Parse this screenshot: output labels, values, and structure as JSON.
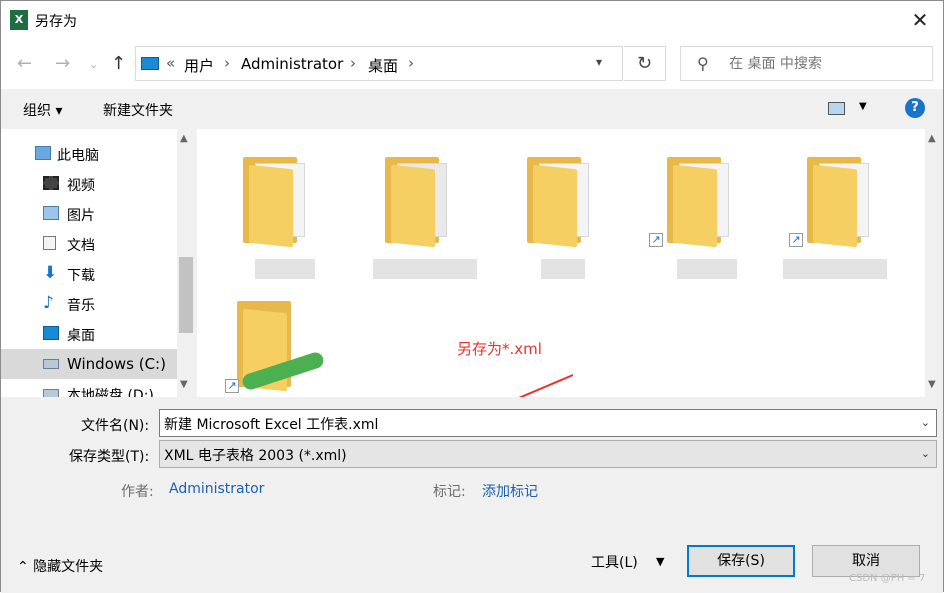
{
  "window": {
    "title": "另存为",
    "app_icon": "excel-icon",
    "close_label": "✕"
  },
  "address": {
    "breadcrumb": [
      "«",
      "用户",
      "Administrator",
      "桌面"
    ],
    "refresh_icon": "refresh-icon",
    "search_placeholder": "在 桌面 中搜索"
  },
  "toolbar": {
    "organize": "组织 ▾",
    "new_folder": "新建文件夹",
    "help": "?"
  },
  "nav": {
    "items": [
      {
        "label": "此电脑",
        "icon": "pc-icon"
      },
      {
        "label": "视频",
        "icon": "video-icon"
      },
      {
        "label": "图片",
        "icon": "image-icon"
      },
      {
        "label": "文档",
        "icon": "document-icon"
      },
      {
        "label": "下载",
        "icon": "download-icon"
      },
      {
        "label": "音乐",
        "icon": "music-icon"
      },
      {
        "label": "桌面",
        "icon": "desktop-icon"
      },
      {
        "label": "Windows (C:)",
        "icon": "drive-icon"
      },
      {
        "label": "本地磁盘 (D:)",
        "icon": "drive-icon"
      }
    ]
  },
  "annotation": {
    "text": "另存为*.xml",
    "color": "#e8332a"
  },
  "form": {
    "filename_label": "文件名(N):",
    "filename_value": "新建 Microsoft Excel 工作表.xml",
    "type_label": "保存类型(T):",
    "type_value": "XML 电子表格 2003 (*.xml)",
    "author_label": "作者:",
    "author_value": "Administrator",
    "tags_label": "标记:",
    "tags_value": "添加标记"
  },
  "footer": {
    "hide_folders": "⌃ 隐藏文件夹",
    "tools": "工具(L)",
    "save": "保存(S)",
    "cancel": "取消",
    "watermark": "CSDN @PH = 7"
  },
  "colors": {
    "accent": "#0078d7",
    "link": "#1a5fb4",
    "folder": "#f5cf62"
  }
}
